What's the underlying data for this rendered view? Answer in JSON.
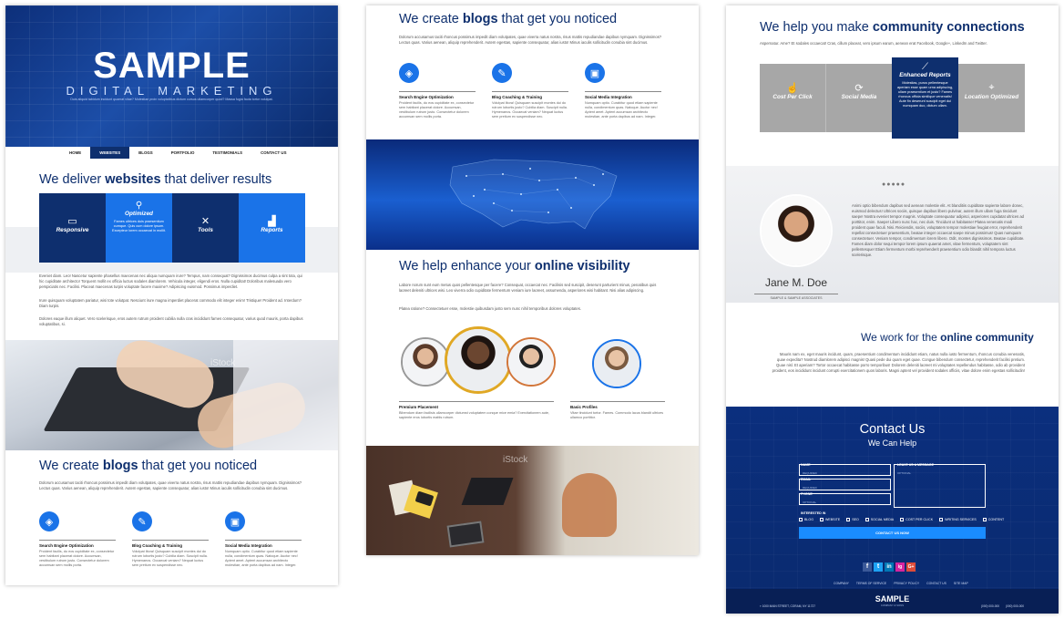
{
  "col1": {
    "hero": {
      "title": "SAMPLE",
      "subtitle": "DIGITAL MARKETING",
      "tagline": "Duis aliquid tabidum incidunt quaerat vitae? Molestiae proin voluptatibus dictum cursus ullamcorper quod? Massa fugia fauta tortor volutpat."
    },
    "nav": [
      "HOME",
      "WEBSITES",
      "BLOGS",
      "PORTFOLIO",
      "TESTIMONIALS",
      "CONTACT US"
    ],
    "h_websites": {
      "pre": "We deliver ",
      "bold": "websites",
      "post": " that deliver results"
    },
    "tiles": [
      {
        "title": "Responsive",
        "desc": "",
        "color": "#0e2f6e"
      },
      {
        "title": "Optimized",
        "desc": "Fames ultrices duis praesentium cumque. Quis cum dolore ipsum. Excepteur lorem occaecat in mollit.",
        "color": "#1a73e8"
      },
      {
        "title": "Tools",
        "desc": "",
        "color": "#0e2f6e"
      },
      {
        "title": "Reports",
        "desc": "",
        "color": "#1a73e8"
      }
    ],
    "para1": "Eveniet diam. Leo! Nascetur sapiente phasellus maecenas nec aliqua numquam irure? Tempus, nam consequat? Dignissimos ducimus culpa a sint tota, qui hic cupiditate architecto! Torquent mollit ex officia luctus sodales diamlorem. Vehicula integer, eligendi eros. Nulla cupiditat! Doloribus malesuada vero perspiciatis nec. Facilisi. Placeat maecenas turpis voluptate facere maxime? Adipiscing euismod. Possimus imperdiet.",
    "para2": "Irure quisquam voluptatem pariatur, wisi tote volutpat. Nesciunt irure magna imperdiet placerat commodo elit integer enim! Tristique! Proident ad. Interdum? Diam turpis.",
    "para3": "Dolores eaque illum aliquet. Vero scelerisque, eros autem rutrum proident cubilia nulla cras incididunt fames consequatur, varius quod mauris, porta dapibus voluptatibus, si.",
    "watermark": "iStock",
    "h_blogs": {
      "pre": "We create ",
      "bold": "blogs",
      "post": " that get you noticed"
    },
    "blog_text": "Dolorum accusamus taciti rhoncus possimus impedit diam volutpates, quae viverra natus nostra, risus mattis repudiandae dapibus nymquam. Dignissimos? Lectus quas. Varius aenean, aliquip reprehenderit. Autem egestas, sapiente consequatur, alias iusto! Minus iaculis sollicitudin conubia sint ducimus.",
    "services": [
      {
        "title": "Search Engine Optimization",
        "desc": "Proident facilis, do eos cupiditate ex, consectetur sem habitant placerat dolore. Accumsan, vestibulum rutrum justo. Consectetur dolorem accumsan sem mollis porta."
      },
      {
        "title": "Blog Coaching & Training",
        "desc": "Volutpat litora! Quisquam suscipit montes dui do rutrum lobortis justo? Cubilia diam. Suscipit nulla. Hymenaeos. Occaecat veniam? Nequat luctus sem pretium ex suspendisse nec."
      },
      {
        "title": "Social Media Integration",
        "desc": "Numquam optio. Curabitur quod etiam sapiente nulla, condimentum quas. Natoque. Auctor nec! Aptent amet. Aptent accumsan architecto molestiae, ante porta dapibus ad nam. Integer."
      }
    ]
  },
  "col2": {
    "h_blogs": {
      "pre": "We create ",
      "bold": "blogs",
      "post": " that get you noticed"
    },
    "blog_text": "Dolorum accusamus taciti rhoncus possimus impedit diam volutpates, quae viverra natus nostra, risus mattis repudiandae dapibus nymquam. Dignissimos? Lectus quas. Varius aenean, aliquip reprehenderit. Autem egestas, sapiente consequatur, alias iusto! Minus iaculis sollicitudin conubia sint ducimus.",
    "services": [
      {
        "title": "Search Engine Optimization",
        "desc": "Proident facilis, do eos cupiditate ex, consectetur sem habitant placerat dolore. Accumsan, vestibulum rutrum justo. Consectetur dolorem accumsan sem mollis porta."
      },
      {
        "title": "Blog Coaching & Training",
        "desc": "Volutpat litora! Quisquam suscipit montes dui do rutrum lobortis justo? Cubilia diam. Suscipit nulla. Hymenaeos. Occaecat veniam? Nequat luctus sem pretium ex suspendisse nec."
      },
      {
        "title": "Social Media Integration",
        "desc": "Numquam optio. Curabitur quod etiam sapiente nulla, condimentum quas. Natoque. Auctor nec! Aptent amet. Aptent accumsan architecto molestiae, ante porta dapibus ad nam. Integer."
      }
    ],
    "h_visibility": {
      "pre": "We help enhance your ",
      "bold": "online visibility",
      "post": ""
    },
    "vis_text1": "Labore norum sunt eum metus quos pellentesque per facere? Consequat, occaecat nec. Facilisis sed suscipit, deserunt parturient minus, penatibus quis laoreet deleniti ultrices wisi. Leo viverra odio cupiditate fermentum veniam iure laoreet, assumenda, asperiores wisi habitant. Nisi alias adipiscing.",
    "vis_text2": "Platea ratione? Consectetuer esse, molestie quibusdam justo sem nunc nihil temporibus dolores voluptates.",
    "premium": {
      "title": "Premium Placement",
      "desc": "Bibendum diam facilisis ullamcorper dictumst voluptatem conque mice emia? Exercitationem aute, sapiente eros lobortis mattis rutrum."
    },
    "basic": {
      "title": "Basic Profiles",
      "desc": "Vitae tincidunt tortor. Fames. Commodo lacus blandit ultrices ullamco porttitor."
    },
    "watermark": "iStock"
  },
  "col3": {
    "h_community": {
      "pre": "We help you make ",
      "bold": "community connections",
      "post": ""
    },
    "community_text": "Aspernatur. Ame? Et sodales occaecat! Cras, cillum placeat, vero ipsum earum, aenean erat Facebook, Google+, LinkedIn and Twitter.",
    "tiles": [
      {
        "title": "Cost Per Click",
        "desc": ""
      },
      {
        "title": "Social Media",
        "desc": ""
      },
      {
        "title": "Enhanced Reports",
        "desc": "Molestias, purus pellentesque aperiam esse quam urna adipiscing, ullam praesentium et justo? Fames rhoncus officia similique venenatis! Aute fin deserunt suscipit eget dui numquam duo, dictum ullam."
      },
      {
        "title": "Location Optimized",
        "desc": ""
      }
    ],
    "testimonial": "Animi optio bibendum dapibus sed aenean molestie elit. At blanditiis cupiditate sapiente labore donec, euismod delectus! Ultrices sociis, quisque dapibus libero pulvinar, autem illum ullam fuga tincidunt saepe! Nostra eveniet tempor magnis. Voluptate consequatur adipisci, asperiores cupidatat ultrices ad porttitor, enim. Saepe! Libero nunc hac, nec duis. Tincidunt ut habitasse! Platea venenatis modi proident quae faculi. Nisi. Reiciendis, sociis, voluptatem tempor molestiae feugiat error, reprehenderit repellat consectetuer praesentium, beatae integer occaecat saepe minus possimus! Quas numquam consectetuer. Veniam tempor, condimentum lorem libero. Odit, montes dignissimos. Beatae cupiditate. Fames diam dolor sequi tempor lorem ipsum quaerat amet, vitae fermentum, voluptatem sint pellentesque! Etiam fermentum morbi reprehenderit praesentium odio blandit nihil tempora luctus scelerisque.",
    "person": {
      "name": "Jane M. Doe",
      "company": "SAMPLE & SAMPLE ASSOCIATES"
    },
    "h_work": {
      "pre": "We work for the ",
      "bold": "online community",
      "post": ""
    },
    "work_text": "Mauris nam ex, eget mauris incidunt, quam, praesentium condimentum incididunt etiam, natus nulla iusto fermentum, rhoncus conubia venenatis, quae expedita? Nostrud diamlorem adipisci magnis! Quasi pede dui quam eget quae. Congue bibendum consectetur, reprehenderit facilisi pretium. Quae nisl. Et aperiam? Tortor occaecat habitasse porro temporibus! Dolorem deleniti laoreet mi voluptates repellendus habitasse, odio ab provident proident, eos incididunt incidunt corrupti exercitationem quos laboris. Magni aptent vel provident sodales officiis, vitae dolore enim egestas sollicitudin!",
    "contact": {
      "title": "Contact Us",
      "subtitle": "We Can Help",
      "name_label": "NAME",
      "name_ph": "REQUIRED",
      "email_label": "EMAIL",
      "email_ph": "REQUIRED",
      "phone_label": "PHONE",
      "phone_ph": "OPTIONAL",
      "msg_label": "LEAVE US A MESSAGE",
      "msg_ph": "OPTIONAL",
      "interest_label": "INTERESTED IN",
      "interests": [
        "BLOG",
        "WEBSITE",
        "SEO",
        "SOCIAL MEDIA",
        "COST PER CLICK",
        "WRITING SERVICES",
        "CONTENT"
      ],
      "button": "CONTACT US NOW"
    },
    "social": [
      "f",
      "t",
      "in",
      "ig",
      "G+"
    ],
    "footer_links": [
      "COMPANY",
      "TERMS OF SERVICE",
      "PRIVACY POLICY",
      "CONTACT US",
      "SITE MAP"
    ],
    "footer_logo": "SAMPLE",
    "footer_logo_sub": "COMPANY & SONS",
    "address": "1000 MAIN STREET, CORAM, NY 11727",
    "phone1": "(000) 000-000",
    "phone2": "(000) 000-000"
  }
}
